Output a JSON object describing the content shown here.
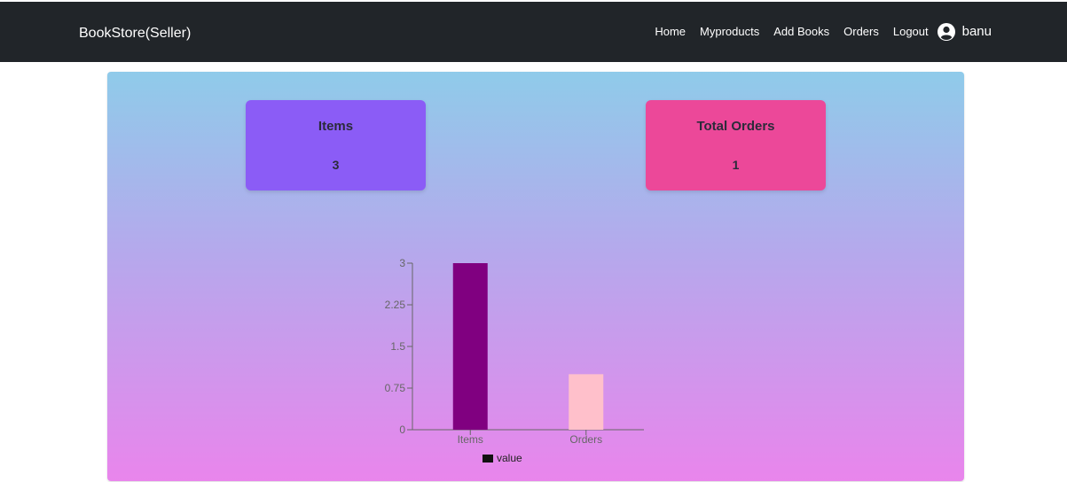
{
  "navbar": {
    "brand": "BookStore(Seller)",
    "links": [
      "Home",
      "Myproducts",
      "Add Books",
      "Orders",
      "Logout"
    ],
    "user_icon": "user-circle-icon",
    "user_name": "banu"
  },
  "cards": {
    "items": {
      "label": "Items",
      "value": "3",
      "color": "#8b5cf6"
    },
    "orders": {
      "label": "Total Orders",
      "value": "1",
      "color": "#ec4899"
    }
  },
  "chart_data": {
    "type": "bar",
    "categories": [
      "Items",
      "Orders"
    ],
    "series": [
      {
        "name": "value",
        "values": [
          3,
          1
        ],
        "colors": [
          "#800080",
          "#ffc0cb"
        ]
      }
    ],
    "y_ticks": [
      "0",
      "0.75",
      "1.5",
      "2.25",
      "3"
    ],
    "ylim": [
      0,
      3
    ],
    "legend": "bottom-center",
    "legend_label": "value",
    "grid": false
  }
}
